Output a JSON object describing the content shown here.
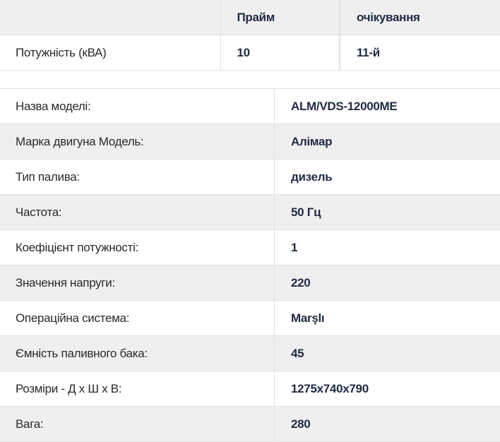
{
  "power_table": {
    "headers": [
      "",
      "Прайм",
      "очікування"
    ],
    "row": {
      "label": "Потужність (кВА)",
      "prime": "10",
      "standby": "11-й"
    }
  },
  "specs": [
    {
      "label": "Назва моделі:",
      "value": "ALM/VDS-12000ME"
    },
    {
      "label": "Марка двигуна Модель:",
      "value": "Алімар"
    },
    {
      "label": "Тип палива:",
      "value": "дизель"
    },
    {
      "label": "Частота:",
      "value": "50 Гц"
    },
    {
      "label": "Коефіцієнт потужності:",
      "value": "1"
    },
    {
      "label": "Значення напруги:",
      "value": "220"
    },
    {
      "label": "Операційна система:",
      "value": "Marşlı"
    },
    {
      "label": "Ємність паливного бака:",
      "value": "45"
    },
    {
      "label": "Розміри - Д х Ш х В:",
      "value": "1275x740x790"
    },
    {
      "label": "Вага:",
      "value": "280"
    }
  ]
}
